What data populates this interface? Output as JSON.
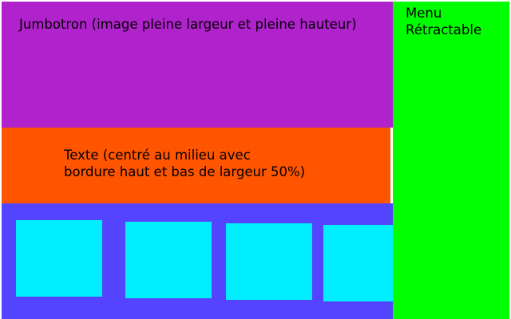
{
  "jumbotron": {
    "label": "Jumbotron (image pleine largeur et pleine hauteur)",
    "color": "#b022cc"
  },
  "text_band": {
    "line1": "Texte (centré au milieu avec",
    "line2": "bordure haut et bas de largeur 50%)",
    "color": "#ff5500"
  },
  "gallery": {
    "color": "#5544ff",
    "item_color": "#00eeff",
    "item_count": 4
  },
  "menu": {
    "line1": "Menu",
    "line2": "Rétractable",
    "color": "#00ff00"
  }
}
